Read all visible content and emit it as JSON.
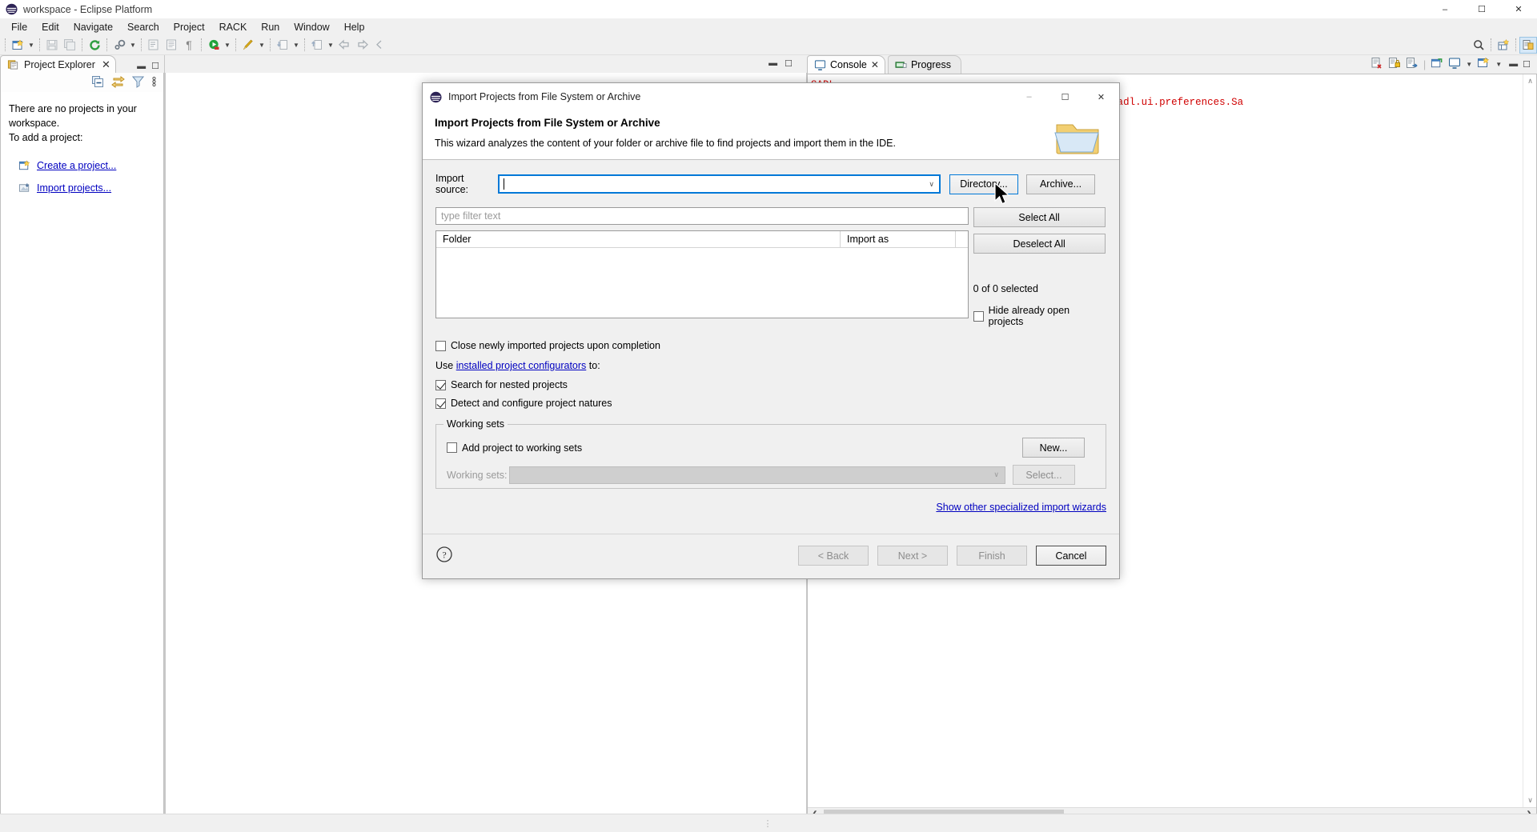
{
  "window": {
    "title": "workspace - Eclipse Platform",
    "app_icon": "eclipse-logo-icon",
    "controls": {
      "minimize": "–",
      "maximize": "☐",
      "close": "✕"
    }
  },
  "menubar": {
    "items": [
      "File",
      "Edit",
      "Navigate",
      "Search",
      "Project",
      "RACK",
      "Run",
      "Window",
      "Help"
    ]
  },
  "toolbar": {
    "icons": [
      "new-wizard-icon",
      "new-dropdown-arrow",
      "save-icon",
      "save-all-icon",
      "refresh-icon",
      "build-settings-icon",
      "build-dropdown-arrow",
      "open-task-icon",
      "open-journal-icon",
      "pilcrow-icon",
      "run-icon",
      "run-dropdown-arrow",
      "debug-icon",
      "debug-dropdown-arrow",
      "import-icon",
      "import-dropdown-arrow",
      "export-icon",
      "export-dropdown-arrow",
      "back-icon",
      "forward-icon",
      "previous-icon",
      "search-icon",
      "new-table-icon",
      "perspective-icon"
    ]
  },
  "project_explorer": {
    "tab_label": "Project Explorer",
    "tab_icon": "project-explorer-icon",
    "tab_close": "✕",
    "view_minimize": "▬",
    "view_maximize": "☐",
    "tools": [
      "collapse-all-icon",
      "link-with-editor-icon",
      "view-menu-filter-icon",
      "view-menu-icon"
    ],
    "empty_text_line1": "There are no projects in your workspace.",
    "empty_text_line2": "To add a project:",
    "links": [
      {
        "icon": "create-project-icon",
        "label": "Create a project..."
      },
      {
        "icon": "import-projects-icon",
        "label": "Import projects..."
      }
    ]
  },
  "console_view": {
    "tabs": [
      {
        "label": "Console",
        "icon": "console-icon",
        "active": true,
        "close": "✕"
      },
      {
        "label": "Progress",
        "icon": "progress-icon",
        "active": false
      }
    ],
    "tools": [
      "clear-console-icon",
      "lock-scroll-icon",
      "show-console-icon",
      "pin-console-icon",
      "display-console-icon",
      "display-dropdown-arrow",
      "open-console-icon",
      "open-console-dropdown-arrow",
      "view-minimize-icon",
      "view-maximize-icon"
    ],
    "hidden_line": "SADL",
    "log_line": "he early startup extensions] INFO com.ge.research.sadl.ui.preferences.Sa",
    "log_color": "#d00000",
    "vscroll_up": "∧",
    "vscroll_down": "∨",
    "hscroll_left": "❮",
    "hscroll_right": "❯"
  },
  "editor_area": {
    "minimize": "▬",
    "maximize": "☐"
  },
  "statusbar": {
    "grip": "⋮"
  },
  "dialog": {
    "titlebar": {
      "icon": "eclipse-logo-icon",
      "title": "Import Projects from File System or Archive",
      "minimize": "–",
      "maximize": "☐",
      "close": "✕"
    },
    "header": {
      "heading": "Import Projects from File System or Archive",
      "description": "This wizard analyzes the content of your folder or archive file to find projects and import them in the IDE.",
      "icon": "folder-wizard-icon"
    },
    "import_source": {
      "label": "Import source:",
      "value": "",
      "placeholder": "",
      "dropdown_arrow": "∨",
      "buttons": [
        {
          "label": "Directory...",
          "name": "directory-button",
          "state": "focused"
        },
        {
          "label": "Archive...",
          "name": "archive-button",
          "state": "normal"
        }
      ]
    },
    "filter": {
      "placeholder": "type filter text",
      "value": ""
    },
    "tree": {
      "columns": [
        "Folder",
        "Import as"
      ],
      "rows": []
    },
    "side_buttons": [
      {
        "label": "Select All",
        "name": "select-all-button"
      },
      {
        "label": "Deselect All",
        "name": "deselect-all-button"
      }
    ],
    "selection_status": "0 of 0 selected",
    "hide_open_projects": {
      "label": "Hide already open projects",
      "checked": false
    },
    "options": [
      {
        "label": "Close newly imported projects upon completion",
        "checked": false
      },
      {
        "label": "Search for nested projects",
        "checked": true
      },
      {
        "label": "Detect and configure project natures",
        "checked": true
      }
    ],
    "configurators_line": {
      "prefix": "Use ",
      "link": "installed project configurators",
      "suffix": " to:"
    },
    "working_sets": {
      "group_title": "Working sets",
      "add_checkbox": {
        "label": "Add project to working sets",
        "checked": false
      },
      "combo_label": "Working sets:",
      "combo_value": "",
      "new_button": "New...",
      "select_button": "Select..."
    },
    "other_wizards_link": "Show other specialized import wizards",
    "footer": {
      "help_icon": "help-icon",
      "buttons": [
        {
          "label": "< Back",
          "name": "back-button",
          "enabled": false
        },
        {
          "label": "Next >",
          "name": "next-button",
          "enabled": false
        },
        {
          "label": "Finish",
          "name": "finish-button",
          "enabled": false
        },
        {
          "label": "Cancel",
          "name": "cancel-button",
          "enabled": true
        }
      ]
    }
  },
  "colors": {
    "accent": "#0078d7",
    "link": "#0000c0",
    "console_text": "#d00000",
    "dialog_bg": "#f0f0f0"
  }
}
